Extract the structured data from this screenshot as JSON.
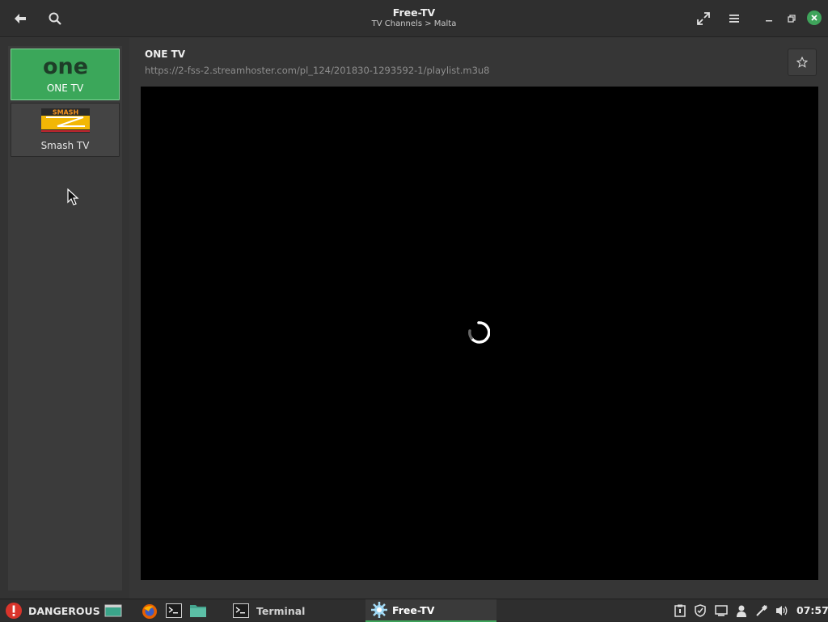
{
  "window": {
    "title": "Free-TV",
    "subtitle": "TV Channels > Malta"
  },
  "icons": {
    "back": "back-arrow-icon",
    "search": "search-icon",
    "fullscreen": "fullscreen-icon",
    "menu": "hamburger-menu-icon",
    "minimize": "minimize-icon",
    "maximize": "maximize-icon",
    "close": "close-icon",
    "favorite": "star-icon"
  },
  "sidebar": {
    "channels": [
      {
        "label": "ONE TV",
        "logo_text": "one",
        "selected": true
      },
      {
        "label": "Smash TV",
        "logo_text": "SMASH",
        "selected": false
      }
    ]
  },
  "player": {
    "channel_title": "ONE TV",
    "stream_url": "https://2-fss-2.streamhoster.com/pl_124/201830-1293592-1/playlist.m3u8",
    "state": "loading"
  },
  "taskbar": {
    "alert_label": "DANGEROUS",
    "tasks": [
      {
        "label": "Terminal",
        "active": false
      },
      {
        "label": "Free-TV",
        "active": true
      }
    ],
    "clock": "07:57"
  },
  "colors": {
    "accent": "#3fa45b",
    "alert": "#d9342b"
  }
}
